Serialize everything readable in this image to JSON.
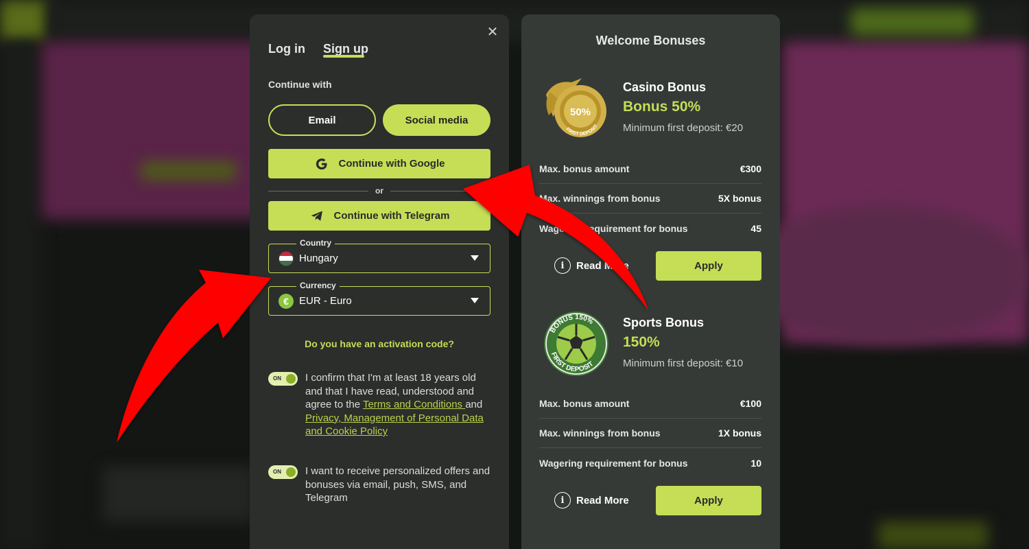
{
  "auth": {
    "tabs": [
      "Log in",
      "Sign up"
    ],
    "active_tab": "Sign up",
    "close_glyph": "✕",
    "continue_label": "Continue with",
    "methods": {
      "email": "Email",
      "social": "Social media"
    },
    "google_button": "Continue with Google",
    "or_text": "or",
    "telegram_button": "Continue with Telegram",
    "country": {
      "legend": "Country",
      "value": "Hungary"
    },
    "currency": {
      "legend": "Currency",
      "value": "EUR - Euro",
      "symbol": "€"
    },
    "activation_link": "Do you have an activation code?",
    "toggle_label": "ON",
    "consent_age": {
      "prefix": "I confirm that I'm at least 18 years old and that I have read, understood and agree to the ",
      "terms_link": "Terms and Conditions ",
      "and": "and ",
      "privacy_link": "Privacy, Management of Personal Data and Cookie Policy"
    },
    "consent_offers": "I want to receive personalized offers and bonuses via email, push, SMS, and Telegram"
  },
  "bonuses": {
    "title": "Welcome Bonuses",
    "casino": {
      "name": "Casino Bonus",
      "value": "Bonus 50%",
      "min_deposit": "Minimum first deposit: €20",
      "badge_text": "50%",
      "badge_ring": "FIRST DEPOSIT",
      "rows": [
        {
          "label": "Max. bonus amount",
          "value": "€300"
        },
        {
          "label": "Max. winnings from bonus",
          "value": "5X bonus"
        },
        {
          "label": "Wagering requirement for bonus",
          "value": "45"
        }
      ],
      "read_more": "Read More",
      "apply": "Apply"
    },
    "sports": {
      "name": "Sports Bonus",
      "value": "150%",
      "min_deposit": "Minimum first deposit: €10",
      "badge_top": "BONUS 150%",
      "badge_bottom": "FIRST DEPOSIT",
      "rows": [
        {
          "label": "Max. bonus amount",
          "value": "€100"
        },
        {
          "label": "Max. winnings from bonus",
          "value": "1X bonus"
        },
        {
          "label": "Wagering requirement for bonus",
          "value": "10"
        }
      ],
      "read_more": "Read More",
      "apply": "Apply"
    }
  },
  "colors": {
    "accent": "#c6dd56",
    "annotation_arrow": "#ff0000",
    "panel_left": "#2b2e2b",
    "panel_right": "#363a37"
  }
}
